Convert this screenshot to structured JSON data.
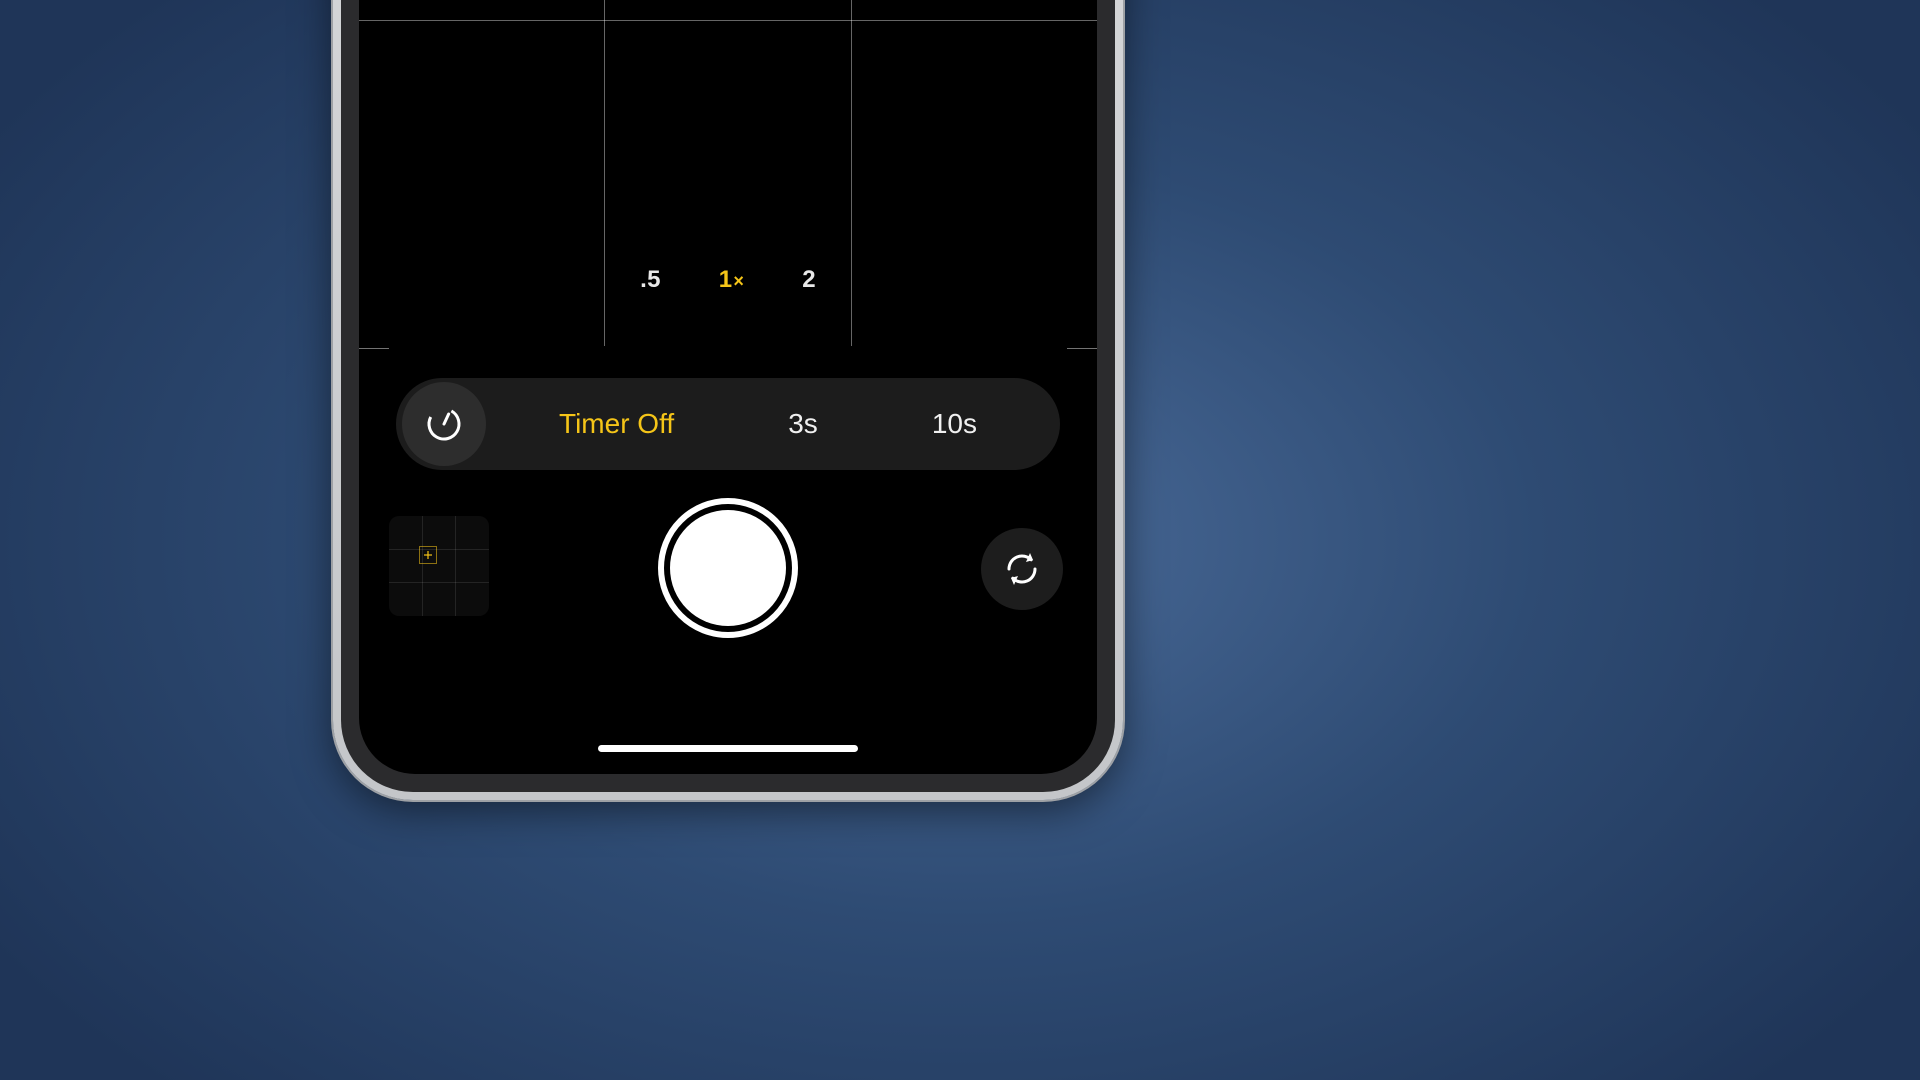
{
  "colors": {
    "accent": "#f5c518",
    "bg_wall": "#22406b",
    "pill": "#1c1c1c",
    "icon_btn": "#2d2d2d"
  },
  "zoom": {
    "options": [
      {
        "label": ".5",
        "active": false
      },
      {
        "label": "1",
        "suffix": "×",
        "active": true
      },
      {
        "label": "2",
        "active": false
      }
    ]
  },
  "timer": {
    "icon": "timer-icon",
    "options": [
      {
        "label": "Timer Off",
        "active": true
      },
      {
        "label": "3s",
        "active": false
      },
      {
        "label": "10s",
        "active": false
      }
    ]
  },
  "controls": {
    "thumbnail": "last-photo-thumbnail",
    "shutter": "shutter-button",
    "flip": "flip-camera-button"
  }
}
